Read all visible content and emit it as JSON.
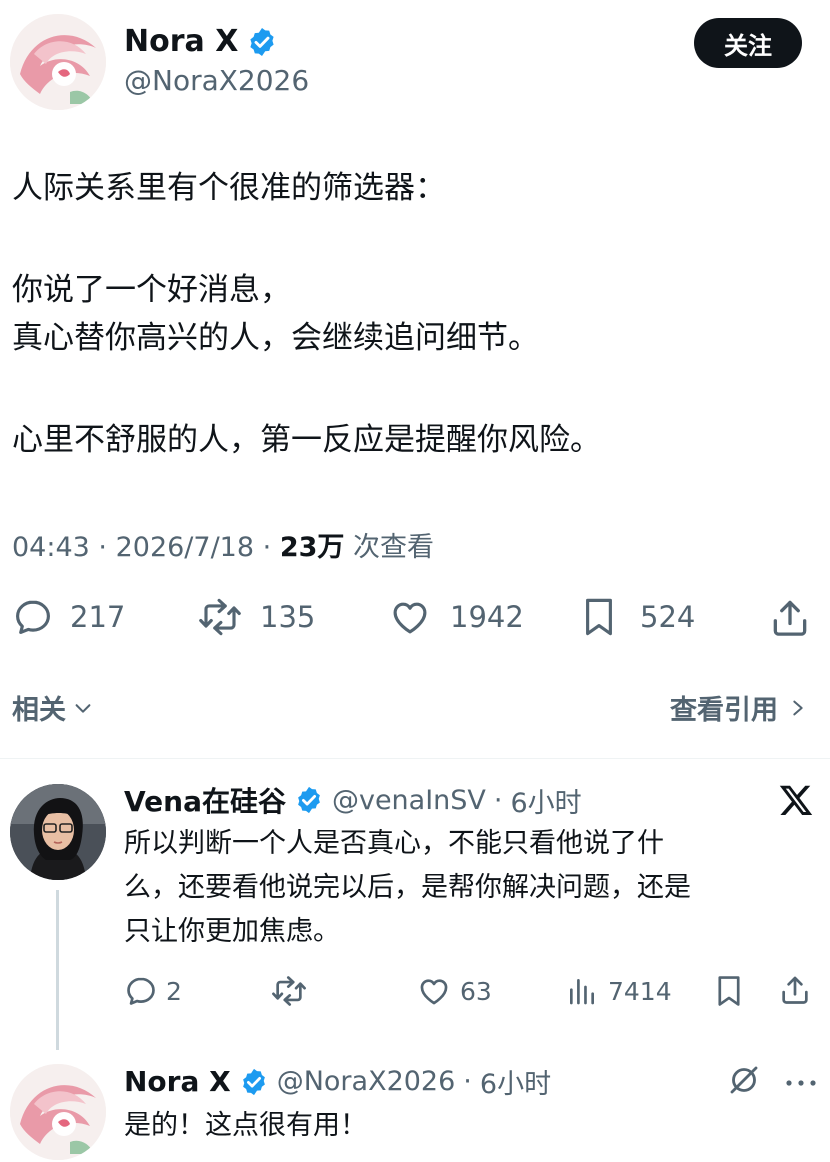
{
  "tweet": {
    "author_name": "Nora X",
    "author_handle": "@NoraX2026",
    "follow_label": "关注",
    "lines": [
      "人际关系里有个很准的筛选器：",
      "你说了一个好消息，",
      "真心替你高兴的人，会继续追问细节。",
      "心里不舒服的人，第一反应是提醒你风险。"
    ],
    "time": "04:43",
    "sep": "·",
    "date": "2026/7/18",
    "views_count": "23万",
    "views_label": "次查看",
    "replies": "217",
    "reposts": "135",
    "likes": "1942",
    "bookmarks": "524"
  },
  "related_label": "相关",
  "quotes_label": "查看引用",
  "reply1": {
    "author_name": "Vena在硅谷",
    "author_handle": "@venaInSV",
    "time": "6小时",
    "lines": [
      "所以判断一个人是否真心，不能只看他说了什",
      "么，还要看他说完以后，是帮你解决问题，还是",
      "只让你更加焦虑。"
    ],
    "replies": "2",
    "likes": "63",
    "views": "7414"
  },
  "reply2": {
    "author_name": "Nora X",
    "author_handle": "@NoraX2026",
    "time": "6小时",
    "text": "是的！这点很有用！"
  },
  "colors": {
    "text": "#0f1419",
    "secondary": "#536471",
    "verified": "#1d9bf0",
    "divider": "#eff3f4"
  }
}
